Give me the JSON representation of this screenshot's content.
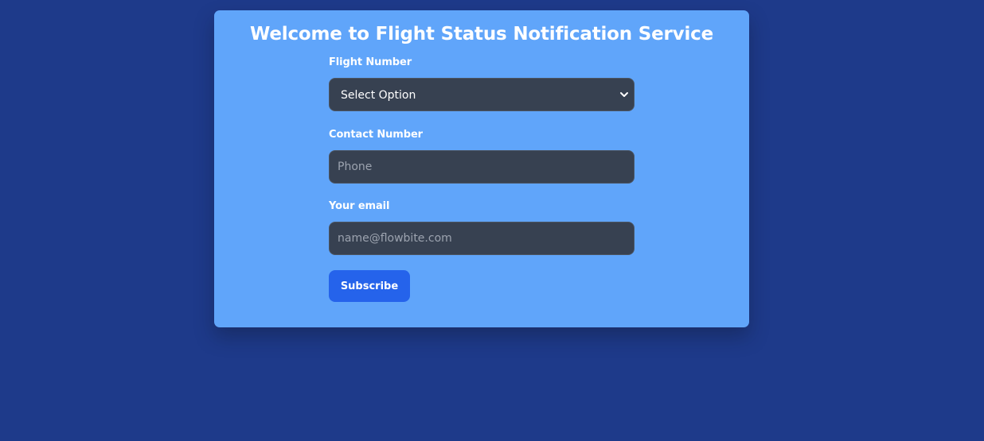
{
  "page": {
    "title": "Welcome to Flight Status Notification Service"
  },
  "form": {
    "flight_number": {
      "label": "Flight Number",
      "selected": "Select Option",
      "icon": "chevron-down-icon"
    },
    "contact_number": {
      "label": "Contact Number",
      "placeholder": "Phone",
      "value": ""
    },
    "email": {
      "label": "Your email",
      "placeholder": "name@flowbite.com",
      "value": ""
    },
    "subscribe_label": "Subscribe"
  },
  "colors": {
    "background": "#1e3a8a",
    "card": "#60a5fa",
    "input_background": "#374151",
    "button": "#2563eb",
    "text": "#ffffff",
    "placeholder": "#9ca3af"
  }
}
